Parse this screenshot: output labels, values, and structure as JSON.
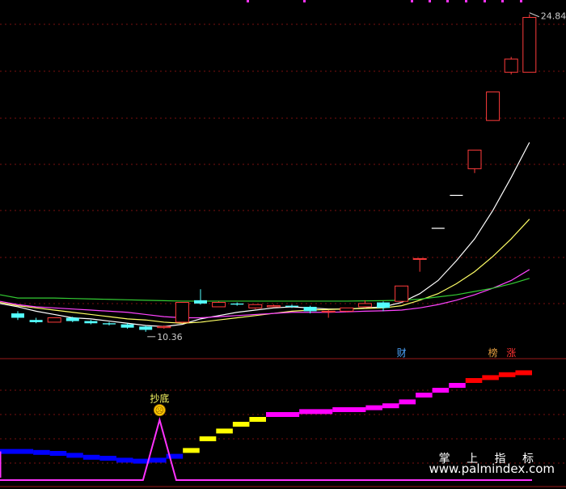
{
  "chart_data": [
    {
      "type": "candlestick",
      "ylim": [
        9.8,
        25.2
      ],
      "annotations": {
        "high_label": "24.84",
        "low_label": "10.36"
      },
      "badges": [
        {
          "text": "财",
          "color": "#4da6ff",
          "index": 21
        },
        {
          "text": "榜",
          "color": "#e8a040",
          "index": 26
        },
        {
          "text": "涨",
          "color": "#ff3030",
          "index": 27
        }
      ],
      "candles": [
        {
          "o": 11.2,
          "h": 11.3,
          "l": 10.9,
          "c": 11.0
        },
        {
          "o": 10.9,
          "h": 11.0,
          "l": 10.75,
          "c": 10.8
        },
        {
          "o": 10.8,
          "h": 11.0,
          "l": 10.8,
          "c": 11.0
        },
        {
          "o": 11.0,
          "h": 11.05,
          "l": 10.8,
          "c": 10.85
        },
        {
          "o": 10.85,
          "h": 10.9,
          "l": 10.7,
          "c": 10.75
        },
        {
          "o": 10.75,
          "h": 10.8,
          "l": 10.65,
          "c": 10.7
        },
        {
          "o": 10.7,
          "h": 10.75,
          "l": 10.5,
          "c": 10.55
        },
        {
          "o": 10.6,
          "h": 10.65,
          "l": 10.36,
          "c": 10.45
        },
        {
          "o": 10.55,
          "h": 10.65,
          "l": 10.5,
          "c": 10.6
        },
        {
          "o": 10.8,
          "h": 11.7,
          "l": 10.75,
          "c": 11.7
        },
        {
          "o": 11.8,
          "h": 12.3,
          "l": 11.6,
          "c": 11.65
        },
        {
          "o": 11.5,
          "h": 11.75,
          "l": 11.5,
          "c": 11.7
        },
        {
          "o": 11.65,
          "h": 11.7,
          "l": 11.55,
          "c": 11.6
        },
        {
          "o": 11.45,
          "h": 11.6,
          "l": 11.4,
          "c": 11.6
        },
        {
          "o": 11.5,
          "h": 11.6,
          "l": 11.5,
          "c": 11.55
        },
        {
          "o": 11.55,
          "h": 11.6,
          "l": 11.45,
          "c": 11.5
        },
        {
          "o": 11.5,
          "h": 11.55,
          "l": 11.2,
          "c": 11.3
        },
        {
          "o": 11.3,
          "h": 11.35,
          "l": 11.0,
          "c": 11.3
        },
        {
          "o": 11.3,
          "h": 11.45,
          "l": 11.25,
          "c": 11.45
        },
        {
          "o": 11.5,
          "h": 11.8,
          "l": 11.45,
          "c": 11.65
        },
        {
          "o": 11.7,
          "h": 11.75,
          "l": 11.3,
          "c": 11.45
        },
        {
          "o": 11.75,
          "h": 12.45,
          "l": 11.7,
          "c": 12.45
        },
        {
          "o": 13.7,
          "h": 13.7,
          "l": 13.1,
          "c": 13.7
        },
        {
          "o": 15.08,
          "h": 15.08,
          "l": 15.08,
          "c": 15.08
        },
        {
          "o": 16.58,
          "h": 16.58,
          "l": 16.58,
          "c": 16.58
        },
        {
          "o": 17.8,
          "h": 18.65,
          "l": 17.6,
          "c": 18.65
        },
        {
          "o": 20.0,
          "h": 21.3,
          "l": 20.0,
          "c": 21.3
        },
        {
          "o": 22.2,
          "h": 22.9,
          "l": 22.1,
          "c": 22.8
        },
        {
          "o": 22.2,
          "h": 24.84,
          "l": 22.2,
          "c": 24.7
        }
      ],
      "ma": [
        {
          "color": "#ffffff",
          "values": [
            11.5,
            11.3,
            11.15,
            11.0,
            10.95,
            10.85,
            10.75,
            10.65,
            10.6,
            10.7,
            10.95,
            11.1,
            11.25,
            11.35,
            11.45,
            11.5,
            11.45,
            11.4,
            11.4,
            11.45,
            11.5,
            11.7,
            12.1,
            12.7,
            13.6,
            14.6,
            15.9,
            17.4,
            19.0
          ]
        },
        {
          "color": "#ffff66",
          "values": [
            11.55,
            11.45,
            11.35,
            11.25,
            11.15,
            11.05,
            10.95,
            10.9,
            10.8,
            10.75,
            10.8,
            10.9,
            11.0,
            11.1,
            11.2,
            11.3,
            11.35,
            11.38,
            11.4,
            11.43,
            11.45,
            11.55,
            11.8,
            12.1,
            12.55,
            13.1,
            13.8,
            14.6,
            15.5
          ]
        },
        {
          "color": "#ff44ff",
          "values": [
            11.6,
            11.5,
            11.45,
            11.4,
            11.35,
            11.3,
            11.25,
            11.15,
            11.05,
            11.0,
            11.0,
            11.05,
            11.1,
            11.15,
            11.2,
            11.25,
            11.25,
            11.25,
            11.27,
            11.3,
            11.32,
            11.35,
            11.45,
            11.6,
            11.8,
            12.05,
            12.35,
            12.7,
            13.2
          ]
        },
        {
          "color": "#33cc33",
          "values": [
            11.9,
            11.9,
            11.9,
            11.88,
            11.86,
            11.84,
            11.82,
            11.8,
            11.78,
            11.76,
            11.76,
            11.76,
            11.76,
            11.76,
            11.76,
            11.76,
            11.76,
            11.76,
            11.76,
            11.77,
            11.78,
            11.8,
            11.85,
            11.95,
            12.05,
            12.2,
            12.35,
            12.55,
            12.8
          ]
        }
      ]
    },
    {
      "type": "step",
      "ylim": [
        0,
        100
      ],
      "signal_label": "抄底",
      "signal_face": "☹",
      "segments": [
        {
          "x0": 0,
          "x1": 10,
          "y": 27,
          "color": "#0000ff"
        },
        {
          "x0": 10,
          "x1": 15,
          "y": 26,
          "color": "#0000ff"
        },
        {
          "x0": 15,
          "x1": 20,
          "y": 25,
          "color": "#0000ff"
        },
        {
          "x0": 20,
          "x1": 25,
          "y": 23,
          "color": "#0000ff"
        },
        {
          "x0": 25,
          "x1": 30,
          "y": 21,
          "color": "#0000ff"
        },
        {
          "x0": 30,
          "x1": 35,
          "y": 20,
          "color": "#0000ff"
        },
        {
          "x0": 35,
          "x1": 40,
          "y": 18,
          "color": "#0000ff"
        },
        {
          "x0": 40,
          "x1": 45,
          "y": 17,
          "color": "#0000ff"
        },
        {
          "x0": 45,
          "x1": 50,
          "y": 18,
          "color": "#0000ff"
        },
        {
          "x0": 50,
          "x1": 55,
          "y": 22,
          "color": "#0000ff"
        },
        {
          "x0": 55,
          "x1": 60,
          "y": 28,
          "color": "#ffff00"
        },
        {
          "x0": 60,
          "x1": 65,
          "y": 40,
          "color": "#ffff00"
        },
        {
          "x0": 65,
          "x1": 70,
          "y": 48,
          "color": "#ffff00"
        },
        {
          "x0": 70,
          "x1": 75,
          "y": 55,
          "color": "#ffff00"
        },
        {
          "x0": 75,
          "x1": 80,
          "y": 60,
          "color": "#ffff00"
        },
        {
          "x0": 80,
          "x1": 90,
          "y": 65,
          "color": "#ff00ff"
        },
        {
          "x0": 90,
          "x1": 100,
          "y": 68,
          "color": "#ff00ff"
        },
        {
          "x0": 100,
          "x1": 110,
          "y": 70,
          "color": "#ff00ff"
        },
        {
          "x0": 110,
          "x1": 115,
          "y": 72,
          "color": "#ff00ff"
        },
        {
          "x0": 115,
          "x1": 120,
          "y": 74,
          "color": "#ff00ff"
        },
        {
          "x0": 120,
          "x1": 125,
          "y": 78,
          "color": "#ff00ff"
        },
        {
          "x0": 125,
          "x1": 130,
          "y": 85,
          "color": "#ff00ff"
        },
        {
          "x0": 130,
          "x1": 135,
          "y": 90,
          "color": "#ff00ff"
        },
        {
          "x0": 135,
          "x1": 140,
          "y": 95,
          "color": "#ff00ff"
        },
        {
          "x0": 140,
          "x1": 145,
          "y": 100,
          "color": "#ff0000"
        },
        {
          "x0": 145,
          "x1": 150,
          "y": 103,
          "color": "#ff0000"
        },
        {
          "x0": 150,
          "x1": 155,
          "y": 106,
          "color": "#ff0000"
        },
        {
          "x0": 155,
          "x1": 160,
          "y": 108,
          "color": "#ff0000"
        }
      ],
      "signal_line": {
        "color": "#ff33ff",
        "x": [
          0,
          43,
          48,
          53,
          160
        ],
        "y": [
          0,
          0,
          62,
          0,
          0
        ]
      }
    }
  ],
  "watermark": {
    "line1": "掌 上 指 标",
    "line2": "www.palmindex.com"
  }
}
